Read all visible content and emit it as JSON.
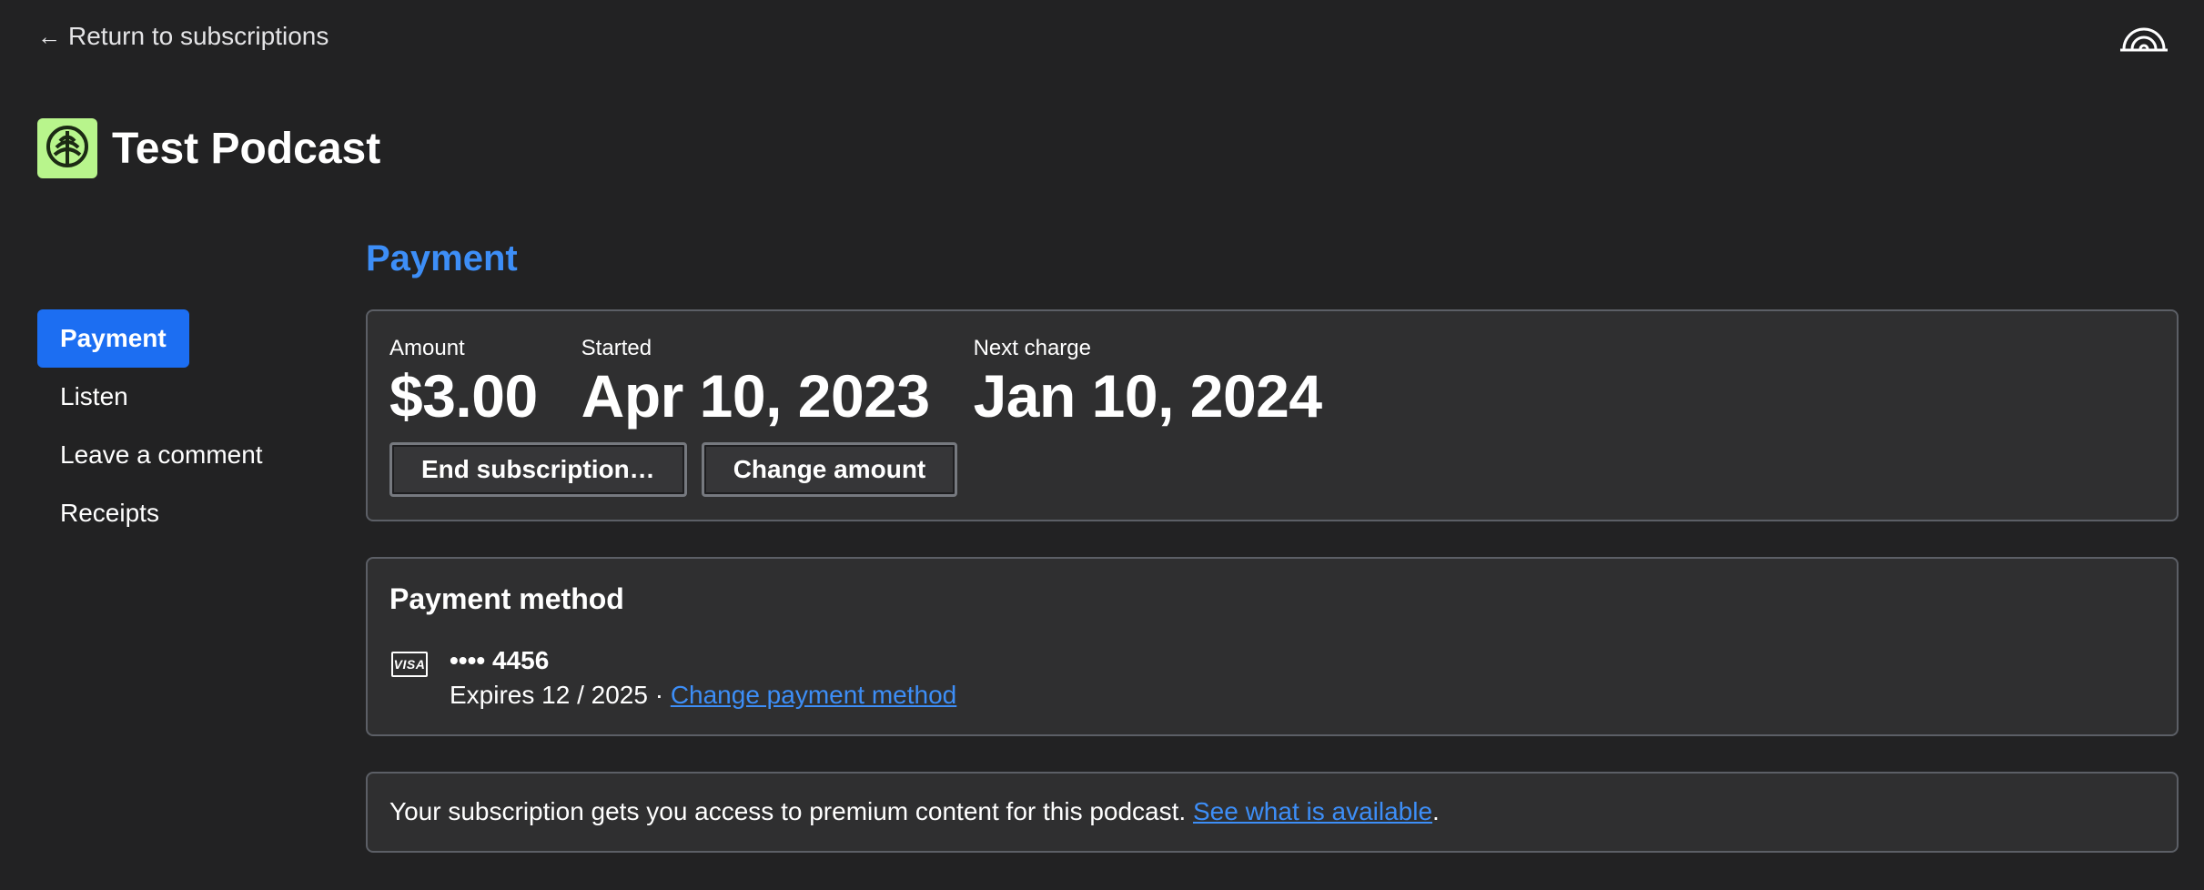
{
  "nav": {
    "return_label": "Return to subscriptions",
    "return_icon": "arrow-left-icon",
    "brand_icon": "rainbow-dome-logo-icon"
  },
  "podcast": {
    "title": "Test Podcast",
    "art_icon": "tree-icon",
    "art_color": "#b8f58c"
  },
  "sidebar": {
    "items": [
      {
        "label": "Payment",
        "active": true
      },
      {
        "label": "Listen",
        "active": false
      },
      {
        "label": "Leave a comment",
        "active": false
      },
      {
        "label": "Receipts",
        "active": false
      }
    ]
  },
  "payment": {
    "section_title": "Payment",
    "amount_label": "Amount",
    "amount_value": "$3.00",
    "started_label": "Started",
    "started_value": "Apr 10, 2023",
    "next_label": "Next charge",
    "next_value": "Jan 10, 2024",
    "end_button": "End subscription…",
    "change_amount_button": "Change amount"
  },
  "payment_method": {
    "title": "Payment method",
    "card_brand_icon": "visa-card-icon",
    "card_brand_text": "VISA",
    "card_number": "•••• 4456",
    "expires_text": "Expires 12 / 2025 · ",
    "change_link": "Change payment method"
  },
  "info": {
    "text": "Your subscription gets you access to premium content for this podcast. ",
    "link": "See what is available",
    "suffix": "."
  },
  "colors": {
    "background": "#222223",
    "card": "#2f2f30",
    "accent": "#3d8ef7",
    "active_nav": "#1c6ef2"
  }
}
